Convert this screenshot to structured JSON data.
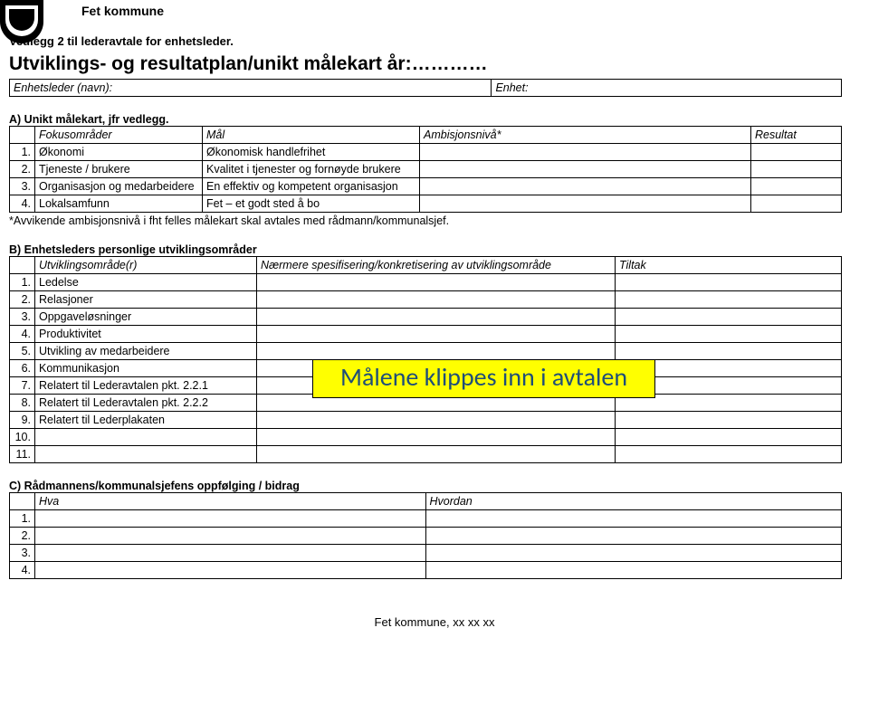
{
  "org_name": "Fet kommune",
  "subtitle": "Vedlegg 2 til lederavtale for enhetsleder.",
  "title": "Utviklings- og resultatplan/unikt målekart år:…………",
  "leader_row": {
    "label1": "Enhetsleder (navn):",
    "label2": "Enhet:"
  },
  "sectionA": {
    "heading": "A) Unikt målekart, jfr vedlegg.",
    "headers": {
      "c1": "Fokusområder",
      "c2": "Mål",
      "c3": "Ambisjonsnivå*",
      "c4": "Resultat"
    },
    "rows": [
      {
        "n": "1.",
        "c1": "Økonomi",
        "c2": "Økonomisk handlefrihet"
      },
      {
        "n": "2.",
        "c1": "Tjeneste / brukere",
        "c2": "Kvalitet i tjenester og fornøyde brukere"
      },
      {
        "n": "3.",
        "c1": "Organisasjon og medarbeidere",
        "c2": "En effektiv og kompetent organisasjon"
      },
      {
        "n": "4.",
        "c1": "Lokalsamfunn",
        "c2": "Fet – et godt sted å bo"
      }
    ],
    "footnote": "*Avvikende ambisjonsnivå i fht felles målekart skal avtales med rådmann/kommunalsjef."
  },
  "sectionB": {
    "heading": "B) Enhetsleders personlige utviklingsområder",
    "headers": {
      "c1": "Utviklingsområde(r)",
      "c2": "Nærmere spesifisering/konkretisering av utviklingsområde",
      "c3": "Tiltak"
    },
    "rows": [
      {
        "n": "1.",
        "c1": "Ledelse"
      },
      {
        "n": "2.",
        "c1": "Relasjoner"
      },
      {
        "n": "3.",
        "c1": "Oppgaveløsninger"
      },
      {
        "n": "4.",
        "c1": "Produktivitet"
      },
      {
        "n": "5.",
        "c1": "Utvikling av medarbeidere"
      },
      {
        "n": "6.",
        "c1": "Kommunikasjon"
      },
      {
        "n": "7.",
        "c1": "Relatert til Lederavtalen pkt. 2.2.1"
      },
      {
        "n": "8.",
        "c1": "Relatert til Lederavtalen pkt. 2.2.2"
      },
      {
        "n": "9.",
        "c1": "Relatert til Lederplakaten"
      },
      {
        "n": "10.",
        "c1": ""
      },
      {
        "n": "11.",
        "c1": ""
      }
    ]
  },
  "overlay": "Målene klippes inn i avtalen",
  "sectionC": {
    "heading": "C) Rådmannens/kommunalsjefens oppfølging / bidrag",
    "headers": {
      "c1": "Hva",
      "c2": "Hvordan"
    },
    "rows": [
      {
        "n": "1."
      },
      {
        "n": "2."
      },
      {
        "n": "3."
      },
      {
        "n": "4."
      }
    ]
  },
  "footer": "Fet kommune, xx xx xx"
}
